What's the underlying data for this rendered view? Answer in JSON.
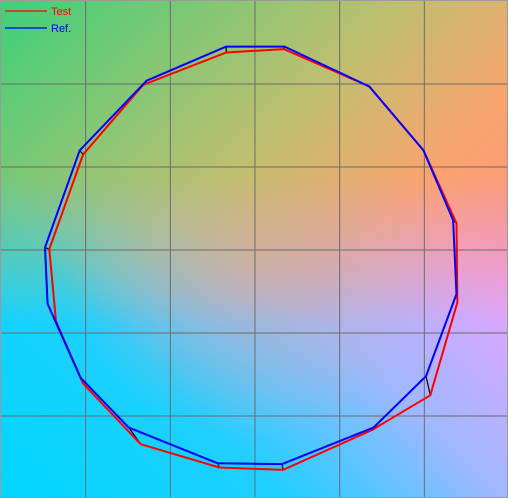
{
  "chart_data": {
    "type": "line",
    "title": "",
    "xlabel": "",
    "ylabel": "",
    "xlim": [
      0,
      6
    ],
    "ylim": [
      0,
      6
    ],
    "grid": true,
    "legend_position": "top-left",
    "series": [
      {
        "name": "Test",
        "color": "#ff0000",
        "points": [
          [
            2.66,
            5.38
          ],
          [
            3.34,
            5.42
          ],
          [
            4.35,
            4.97
          ],
          [
            4.99,
            4.2
          ],
          [
            5.38,
            3.32
          ],
          [
            5.39,
            2.37
          ],
          [
            5.07,
            1.25
          ],
          [
            4.38,
            0.83
          ],
          [
            3.33,
            0.35
          ],
          [
            2.58,
            0.38
          ],
          [
            1.65,
            0.66
          ],
          [
            0.97,
            1.39
          ],
          [
            0.65,
            2.14
          ],
          [
            0.57,
            3.01
          ],
          [
            0.97,
            4.15
          ],
          [
            1.68,
            4.99
          ],
          [
            2.66,
            5.38
          ]
        ]
      },
      {
        "name": "Ref.",
        "color": "#0000ff",
        "points": [
          [
            2.66,
            5.45
          ],
          [
            3.35,
            5.45
          ],
          [
            4.35,
            4.97
          ],
          [
            4.99,
            4.2
          ],
          [
            5.34,
            3.36
          ],
          [
            5.38,
            2.47
          ],
          [
            5.02,
            1.48
          ],
          [
            4.4,
            0.86
          ],
          [
            3.32,
            0.42
          ],
          [
            2.56,
            0.43
          ],
          [
            1.51,
            0.86
          ],
          [
            0.94,
            1.46
          ],
          [
            0.55,
            2.35
          ],
          [
            0.52,
            3.03
          ],
          [
            0.93,
            4.2
          ],
          [
            1.72,
            5.04
          ],
          [
            2.66,
            5.45
          ]
        ]
      }
    ]
  }
}
